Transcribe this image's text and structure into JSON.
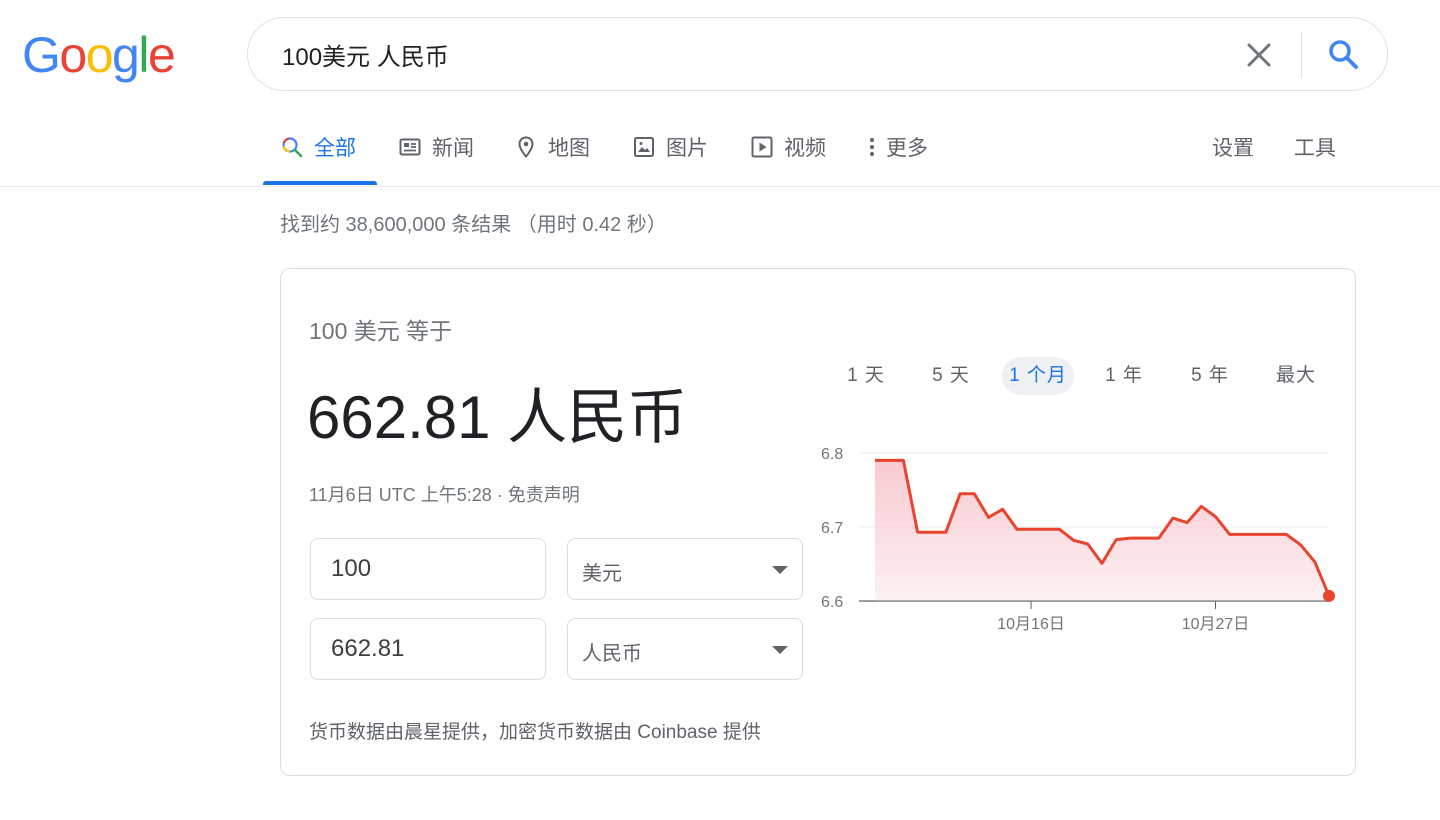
{
  "logo": {
    "letters": [
      "G",
      "o",
      "o",
      "g",
      "l",
      "e"
    ],
    "colors": [
      "#4285F4",
      "#EA4335",
      "#FBBC05",
      "#4285F4",
      "#34A853",
      "#EA4335"
    ]
  },
  "search": {
    "query": "100美元 人民币",
    "clear_icon": "close-icon",
    "search_icon": "search-icon"
  },
  "tabs": [
    {
      "label": "全部",
      "icon": "search-icon",
      "active": true
    },
    {
      "label": "新闻",
      "icon": "news-icon"
    },
    {
      "label": "地图",
      "icon": "map-pin-icon"
    },
    {
      "label": "图片",
      "icon": "image-icon"
    },
    {
      "label": "视频",
      "icon": "video-icon"
    },
    {
      "label": "更多",
      "icon": "more-vert-icon"
    }
  ],
  "tools": {
    "settings": "设置",
    "tools": "工具"
  },
  "stats": "找到约 38,600,000 条结果 （用时 0.42 秒）",
  "converter": {
    "label": "100 美元 等于",
    "result": "662.81 人民币",
    "timestamp": "11月6日 UTC 上午5:28 · 免责声明",
    "from_amount": "100",
    "from_currency": "美元",
    "to_amount": "662.81",
    "to_currency": "人民币",
    "source": "货币数据由晨星提供，加密货币数据由 Coinbase 提供"
  },
  "ranges": [
    {
      "label": "1 天"
    },
    {
      "label": "5 天"
    },
    {
      "label": "1 个月",
      "active": true
    },
    {
      "label": "1 年"
    },
    {
      "label": "5 年"
    },
    {
      "label": "最大"
    }
  ],
  "colors": {
    "accent": "#1a73e8",
    "line": "#e8452e",
    "fill": "#f7c7cf"
  },
  "chart_data": {
    "type": "area",
    "ylim": [
      6.6,
      6.8
    ],
    "yticks": [
      "6.8",
      "6.7",
      "6.6"
    ],
    "xticks": [
      {
        "label": "10月16日",
        "index": 11
      },
      {
        "label": "10月27日",
        "index": 24
      }
    ],
    "values": [
      6.79,
      6.79,
      6.79,
      6.693,
      6.693,
      6.693,
      6.745,
      6.745,
      6.713,
      6.724,
      6.697,
      6.697,
      6.697,
      6.697,
      6.682,
      6.677,
      6.651,
      6.683,
      6.685,
      6.685,
      6.685,
      6.712,
      6.706,
      6.728,
      6.714,
      6.69,
      6.69,
      6.69,
      6.69,
      6.69,
      6.676,
      6.653,
      6.607
    ],
    "grid": true
  }
}
